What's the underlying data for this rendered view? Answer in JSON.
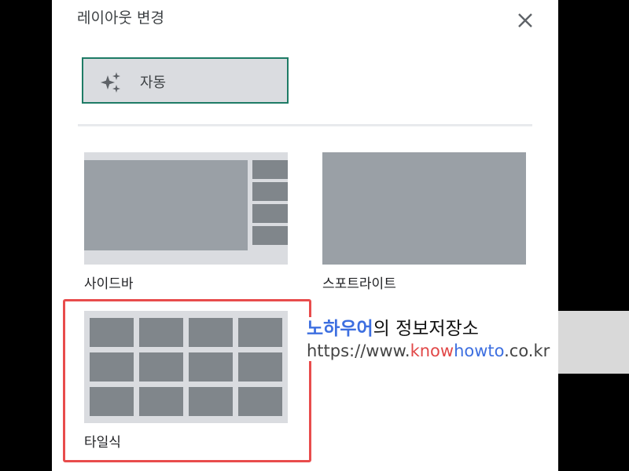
{
  "dialog": {
    "title": "레이아웃 변경",
    "close_icon": "close-icon"
  },
  "auto_option": {
    "label": "자동",
    "icon": "sparkle-icon",
    "selected": true
  },
  "layouts": [
    {
      "label": "사이드바",
      "icon": "sidebar-layout"
    },
    {
      "label": "스포트라이트",
      "icon": "spotlight-layout"
    },
    {
      "label": "타일식",
      "icon": "tiled-layout"
    }
  ],
  "watermark": {
    "brand": "노하우어",
    "brand_suffix": "의 정보저장소",
    "url_prefix": "https://www.",
    "url_know": "know",
    "url_howto": "howto",
    "url_suffix": ".co.kr"
  },
  "colors": {
    "selected_border": "#1e7b66",
    "highlight": "#e84c4c"
  }
}
